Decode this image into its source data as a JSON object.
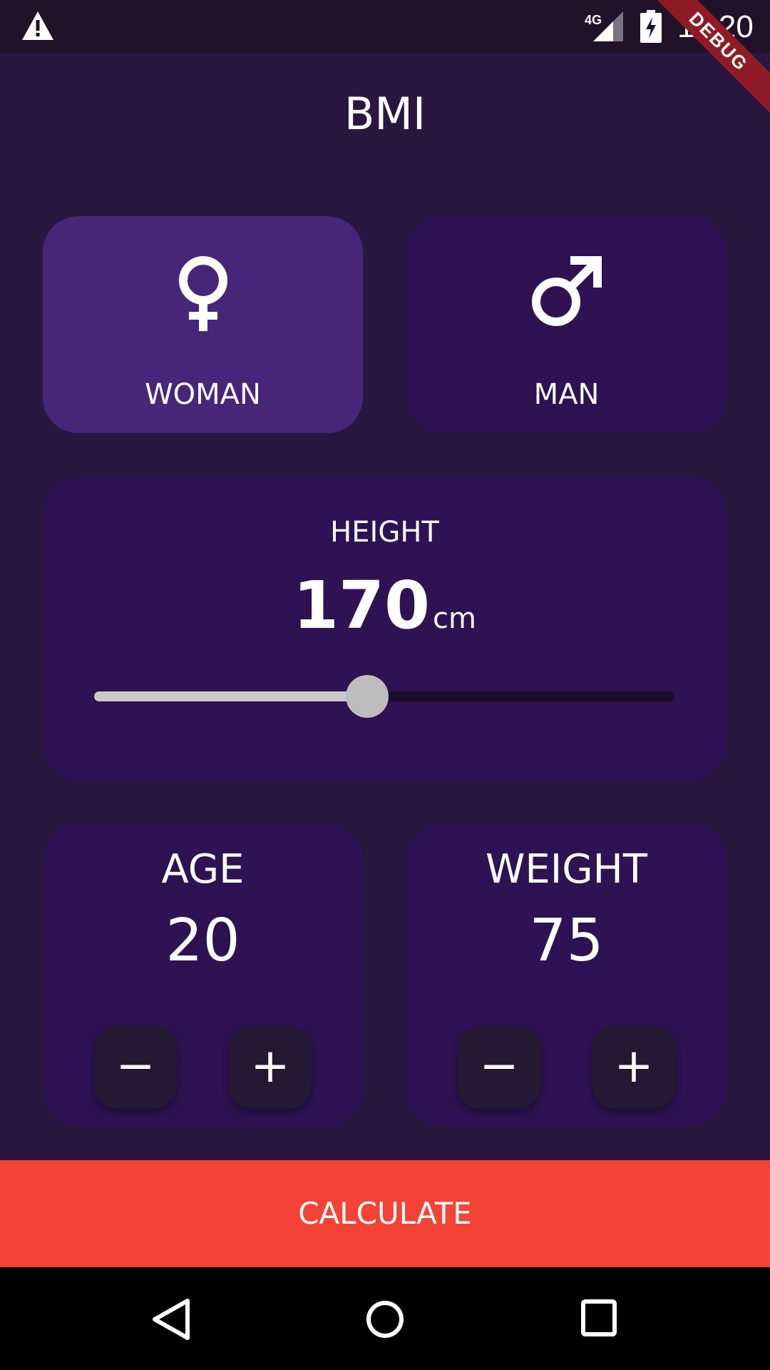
{
  "status_bar": {
    "network": "4G",
    "time": "11:20",
    "debug_label": "DEBUG"
  },
  "app": {
    "title": "BMI"
  },
  "gender": {
    "woman_label": "WOMAN",
    "man_label": "MAN",
    "selected": "woman"
  },
  "height": {
    "label": "HEIGHT",
    "value": "170",
    "unit": "cm",
    "slider_fraction": 0.47
  },
  "age": {
    "label": "AGE",
    "value": "20",
    "minus": "−",
    "plus": "+"
  },
  "weight": {
    "label": "WEIGHT",
    "value": "75",
    "minus": "−",
    "plus": "+"
  },
  "actions": {
    "calculate_label": "CALCULATE"
  },
  "colors": {
    "background": "#2a173f",
    "card": "#2e1253",
    "card_active": "#472679",
    "accent": "#f44236"
  },
  "icons": [
    "warning-icon",
    "signal-icon",
    "battery-icon",
    "female-icon",
    "male-icon",
    "back-icon",
    "home-icon",
    "recents-icon"
  ]
}
